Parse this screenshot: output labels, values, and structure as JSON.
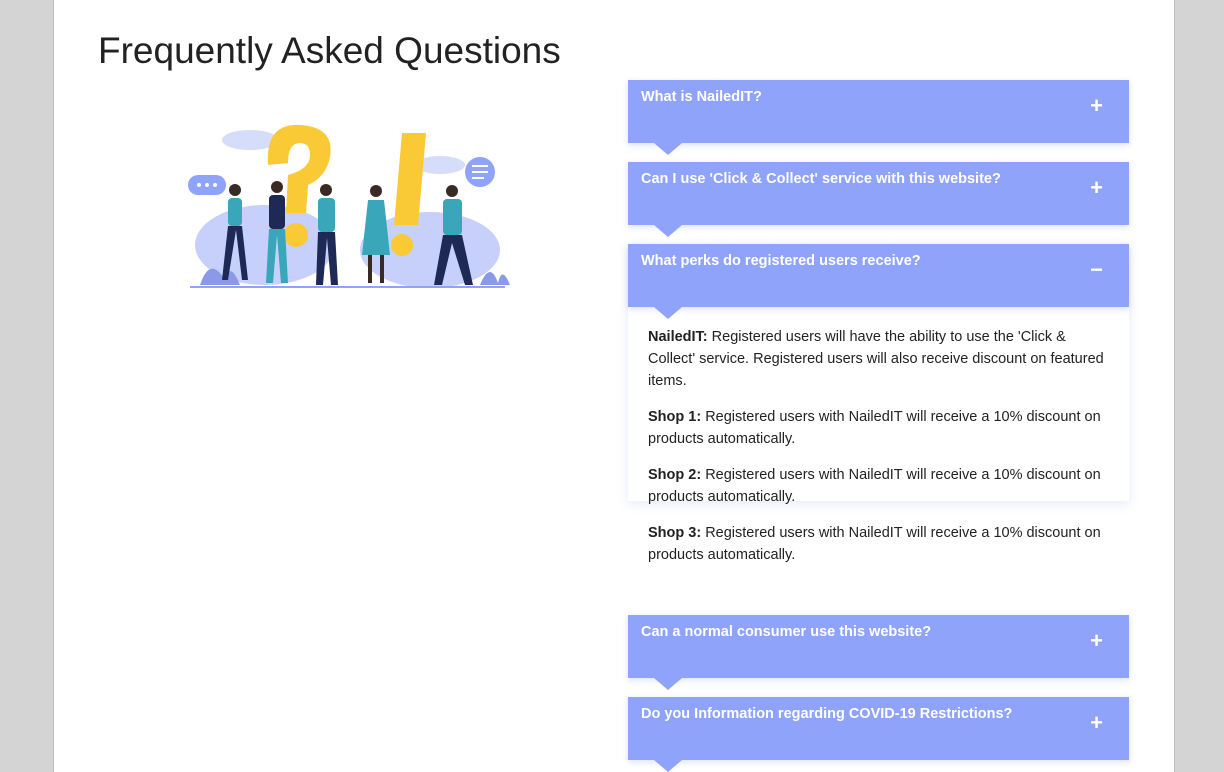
{
  "page": {
    "title": "Frequently Asked Questions"
  },
  "faq": [
    {
      "question": "What is NailedIT?",
      "sign": "+",
      "expanded": false
    },
    {
      "question": "Can I use 'Click & Collect' service with this website?",
      "sign": "+",
      "expanded": false
    },
    {
      "question": "What perks do registered users receive?",
      "sign": "−",
      "expanded": true,
      "answers": [
        {
          "label": "NailedIT:",
          "text": " Registered users will have the ability to use the 'Click & Collect' service. Registered users will also receive discount on featured items."
        },
        {
          "label": "Shop 1:",
          "text": " Registered users with NailedIT will receive a 10% discount on products automatically."
        },
        {
          "label": "Shop 2:",
          "text": " Registered users with NailedIT will receive a 10% discount on products automatically."
        },
        {
          "label": "Shop 3:",
          "text": " Registered users with NailedIT will receive a 10% discount on products automatically."
        }
      ]
    },
    {
      "question": "Can a normal consumer use this website?",
      "sign": "+",
      "expanded": false
    },
    {
      "question": "Do you Information regarding COVID-19 Restrictions?",
      "sign": "+",
      "expanded": false
    }
  ],
  "colors": {
    "accent": "#8fa3fb",
    "page_bg": "#ffffff",
    "outer_bg": "#d4d4d4"
  }
}
